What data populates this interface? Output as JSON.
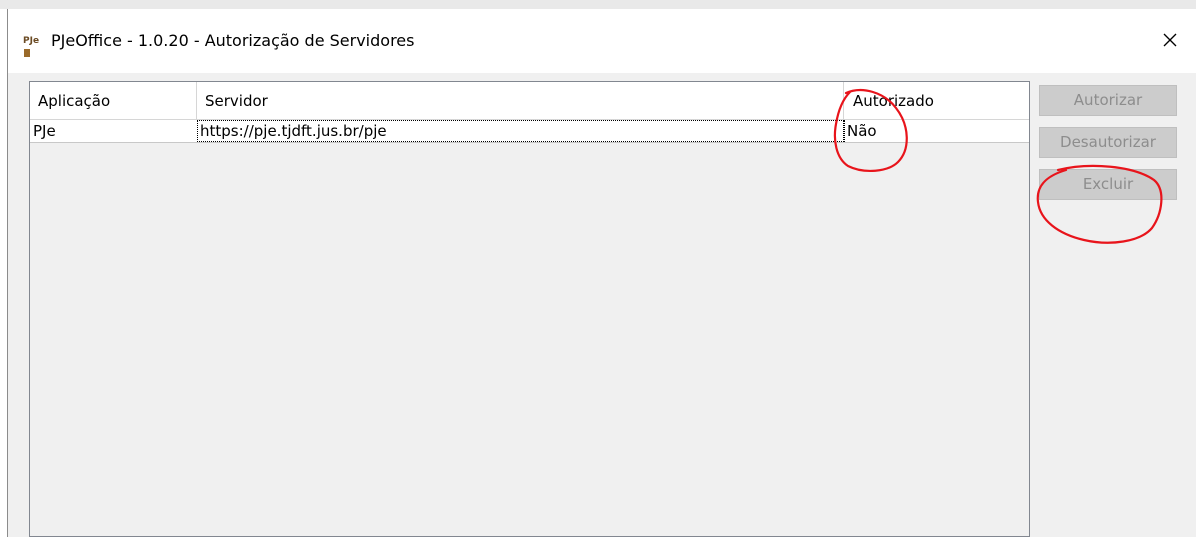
{
  "window": {
    "logo_text": "PJe",
    "title": "PJeOffice - 1.0.20 - Autorização de Servidores",
    "close_glyph": "close-icon"
  },
  "table": {
    "columns": [
      "Aplicação",
      "Servidor",
      "Autorizado"
    ],
    "rows": [
      {
        "aplicacao": "PJe",
        "servidor": "https://pje.tjdft.jus.br/pje",
        "autorizado": "Não"
      }
    ]
  },
  "buttons": {
    "autorizar": "Autorizar",
    "desautorizar": "Desautorizar",
    "excluir": "Excluir"
  },
  "annotation_color": "#e8141b"
}
